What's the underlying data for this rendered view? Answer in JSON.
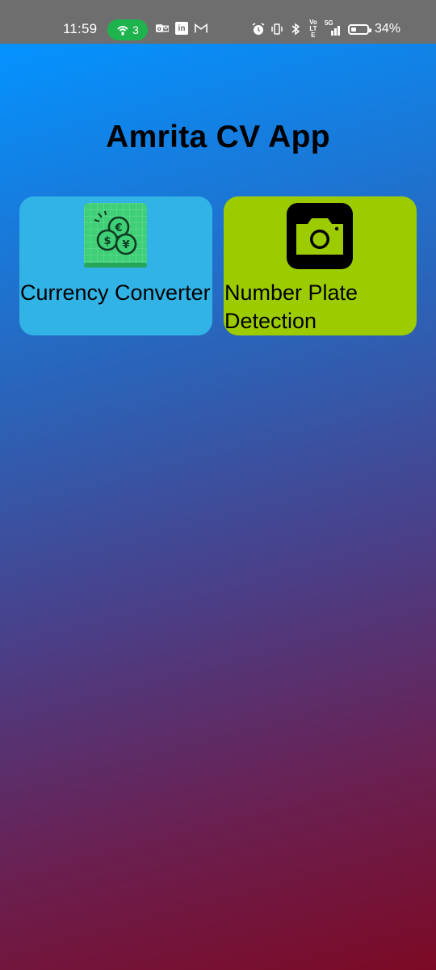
{
  "status_bar": {
    "time": "11:59",
    "hotspot_count": "3",
    "battery": "34%",
    "battery_level": 0.34,
    "network_labels": {
      "volte": "Vo LTE",
      "five_g": "5G"
    },
    "left_icons": [
      "hotspot-icon",
      "outlook-icon",
      "linkedin-icon",
      "gmail-icon"
    ],
    "right_icons": [
      "alarm-icon",
      "vibrate-icon",
      "bluetooth-icon",
      "volte-icon",
      "signal-icon",
      "battery-icon"
    ]
  },
  "app": {
    "title": "Amrita CV App",
    "colors": {
      "gradient_top": "#0493ff",
      "gradient_bottom": "#7c0a25"
    },
    "cards": [
      {
        "label": "Currency Converter",
        "icon": "currency-coins-icon",
        "color": "#31b3e6"
      },
      {
        "label": "Number Plate Detection",
        "icon": "camera-icon",
        "color": "#9ccc00"
      }
    ]
  }
}
